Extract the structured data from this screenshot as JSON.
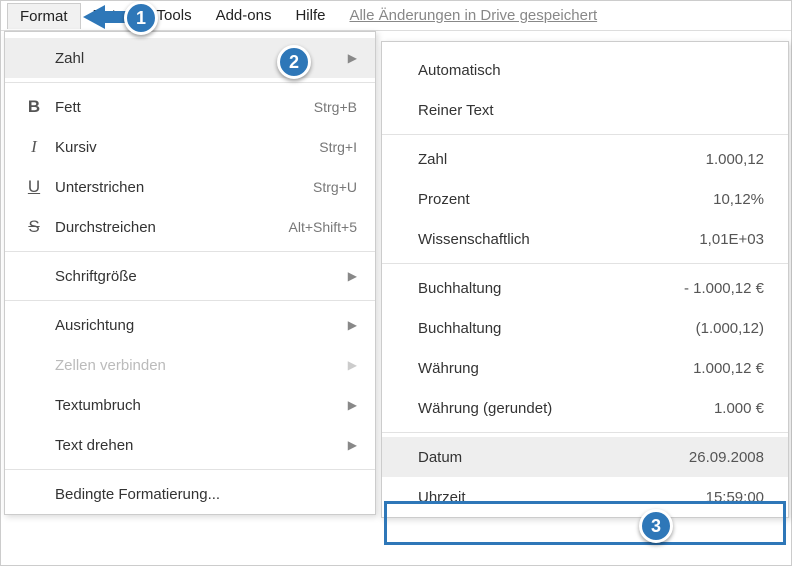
{
  "menubar": {
    "format": "Format",
    "daten": "Daten",
    "tools": "Tools",
    "addons": "Add-ons",
    "hilfe": "Hilfe",
    "status": "Alle Änderungen in Drive gespeichert"
  },
  "badges": {
    "b1": "1",
    "b2": "2",
    "b3": "3"
  },
  "menu": {
    "zahl": {
      "label": "Zahl"
    },
    "fett": {
      "icon": "B",
      "label": "Fett",
      "shortcut": "Strg+B"
    },
    "kursiv": {
      "icon": "I",
      "label": "Kursiv",
      "shortcut": "Strg+I"
    },
    "unterstrichen": {
      "icon": "U",
      "label": "Unterstrichen",
      "shortcut": "Strg+U"
    },
    "durchstreichen": {
      "icon": "S",
      "label": "Durchstreichen",
      "shortcut": "Alt+Shift+5"
    },
    "schriftgroesse": {
      "label": "Schriftgröße"
    },
    "ausrichtung": {
      "label": "Ausrichtung"
    },
    "zellen_verbinden": {
      "label": "Zellen verbinden"
    },
    "textumbruch": {
      "label": "Textumbruch"
    },
    "text_drehen": {
      "label": "Text drehen"
    },
    "bedingte_formatierung": {
      "label": "Bedingte Formatierung..."
    }
  },
  "submenu": {
    "automatisch": {
      "label": "Automatisch",
      "value": ""
    },
    "reiner_text": {
      "label": "Reiner Text",
      "value": ""
    },
    "zahl": {
      "label": "Zahl",
      "value": "1.000,12"
    },
    "prozent": {
      "label": "Prozent",
      "value": "10,12%"
    },
    "wissenschaftlich": {
      "label": "Wissenschaftlich",
      "value": "1,01E+03"
    },
    "buchhaltung1": {
      "label": "Buchhaltung",
      "value": "- 1.000,12 €"
    },
    "buchhaltung2": {
      "label": "Buchhaltung",
      "value": "(1.000,12)"
    },
    "waehrung": {
      "label": "Währung",
      "value": "1.000,12 €"
    },
    "waehrung_gerundet": {
      "label": "Währung (gerundet)",
      "value": "1.000 €"
    },
    "datum": {
      "label": "Datum",
      "value": "26.09.2008"
    },
    "uhrzeit": {
      "label": "Uhrzeit",
      "value": "15:59:00"
    }
  },
  "glyphs": {
    "tri": "▶"
  }
}
